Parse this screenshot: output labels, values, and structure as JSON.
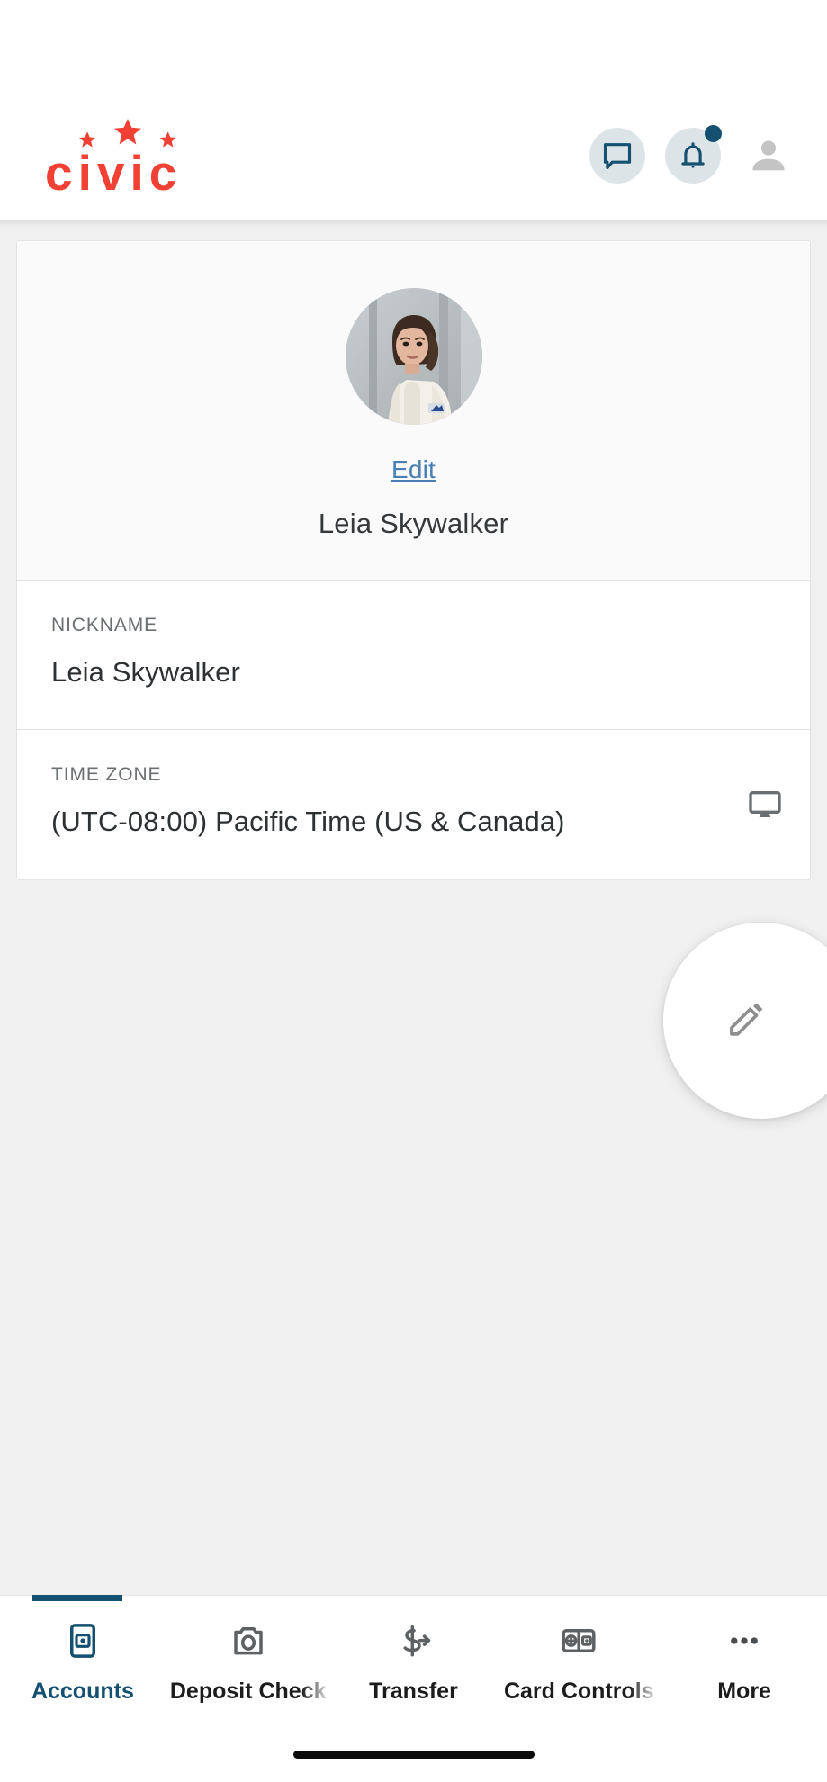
{
  "app": {
    "brand_name": "civic",
    "brand_color": "#f04134",
    "accent_color": "#14506f",
    "link_color": "#4a7fb5"
  },
  "header": {
    "logo_label": "civic",
    "actions": [
      {
        "name": "messages",
        "icon": "chat-bubble-icon",
        "badge": false
      },
      {
        "name": "notifications",
        "icon": "bell-icon",
        "badge": true
      },
      {
        "name": "profile",
        "icon": "person-icon",
        "badge": false
      }
    ]
  },
  "profile": {
    "photo_alt": "Leia Skywalker profile photo",
    "edit_label": "Edit",
    "display_name": "Leia Skywalker"
  },
  "fields": [
    {
      "label": "NICKNAME",
      "value": "Leia Skywalker",
      "icon": ""
    },
    {
      "label": "TIME ZONE",
      "value": "(UTC-08:00) Pacific Time (US & Canada)",
      "icon": "monitor-icon"
    }
  ],
  "fab": {
    "icon": "pencil-icon",
    "label": ""
  },
  "bottom_nav": {
    "active_index": 0,
    "items": [
      {
        "label": "Accounts",
        "icon": "mobile-card-icon",
        "clipped": false
      },
      {
        "label": "Deposit Check",
        "icon": "camera-icon",
        "clipped": true
      },
      {
        "label": "Transfer",
        "icon": "dollar-arrow-icon",
        "clipped": false
      },
      {
        "label": "Card Controls",
        "icon": "card-toggle-icon",
        "clipped": true
      },
      {
        "label": "More",
        "icon": "ellipsis-icon",
        "clipped": false
      }
    ]
  }
}
